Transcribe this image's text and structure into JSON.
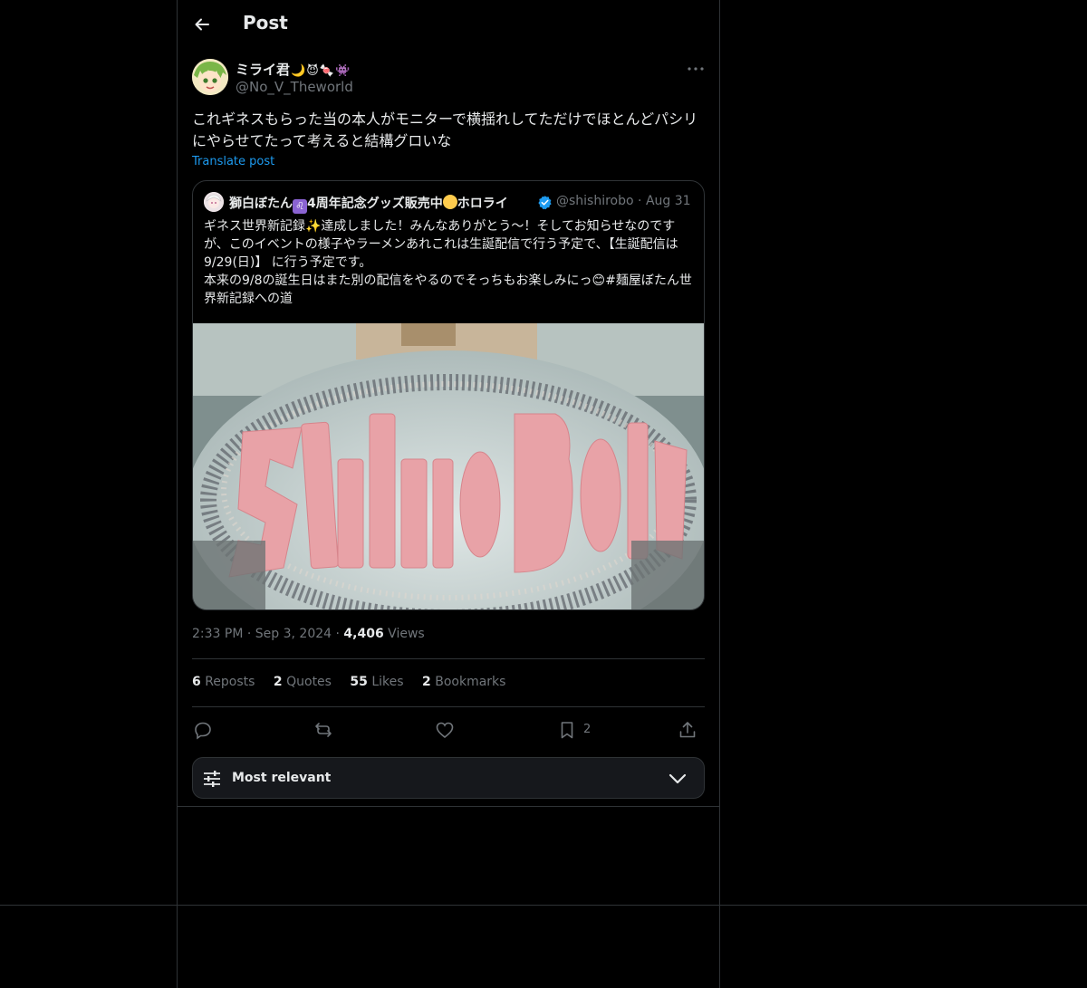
{
  "header": {
    "title": "Post"
  },
  "post": {
    "author_name": "ミライ君",
    "author_emojis": [
      "🌙",
      "😈",
      "🍬",
      "👾"
    ],
    "author_handle": "@No_V_Theworld",
    "text": "これギネスもらった当の本人がモニターで横揺れしてただけでほとんどパシリにやらせてたって考えると結構グロいな",
    "translate_label": "Translate post",
    "time": "2:33 PM",
    "date": "Sep 3, 2024",
    "views_count": "4,406",
    "views_label": "Views"
  },
  "quote": {
    "name_part1": "獅白ぼたん",
    "name_part2": "4周年記念グッズ販売中",
    "name_part3": "ホロライ",
    "handle": "@shishirobo",
    "date": "Aug 31",
    "text": "ギネス世界新記録✨達成しました！みんなありがとう～！そしてお知らせなのですが、このイベントの様子やラーメンあれこれは生誕配信で行う予定で、【生誕配信は9/29(日)】 に行う予定です。\n本来の9/8の誕生日はまた別の配信をやるのでそっちもお楽しみにっ😊#麺屋ぼたん世界新記録への道",
    "image_text": "Shishiro Botan"
  },
  "stats": [
    {
      "count": "6",
      "label": "Reposts"
    },
    {
      "count": "2",
      "label": "Quotes"
    },
    {
      "count": "55",
      "label": "Likes"
    },
    {
      "count": "2",
      "label": "Bookmarks"
    }
  ],
  "actions": {
    "bookmark_count": "2"
  },
  "sort": {
    "label": "Most relevant"
  },
  "colors": {
    "background": "#000000",
    "border": "#2f3336",
    "accent": "#1d9bf0",
    "muted": "#71767b",
    "text": "#e7e9ea"
  }
}
